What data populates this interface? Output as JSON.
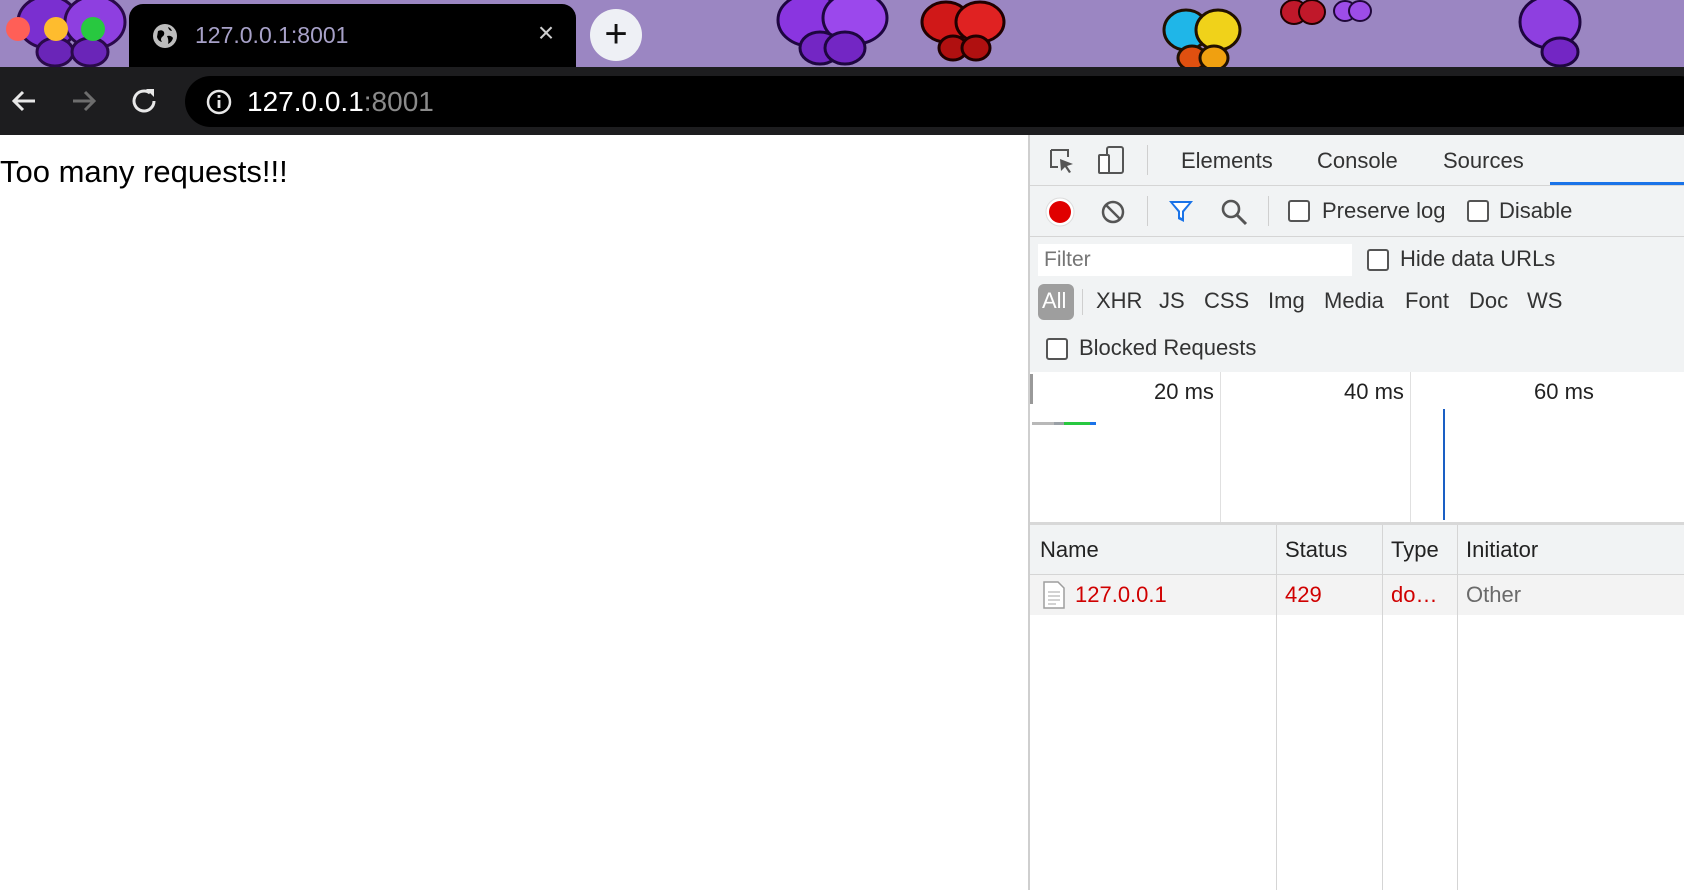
{
  "window": {
    "traffic_lights": {
      "close_color": "#ff5f57",
      "minimize_color": "#febc2e",
      "zoom_color": "#28c840"
    }
  },
  "tab": {
    "title": "127.0.0.1:8001",
    "favicon": "globe-icon",
    "close_icon": "close-icon"
  },
  "new_tab": {
    "icon": "plus-icon"
  },
  "toolbar": {
    "back_icon": "back-arrow-icon",
    "forward_icon": "forward-arrow-icon",
    "reload_icon": "reload-icon",
    "site_info_icon": "info-icon",
    "url_host": "127.0.0.1",
    "url_port": ":8001"
  },
  "page": {
    "message": "Too many requests!!!"
  },
  "devtools": {
    "tabs": [
      {
        "label": "Elements"
      },
      {
        "label": "Console"
      },
      {
        "label": "Sources"
      }
    ],
    "icons": {
      "inspect": "inspect-element-icon",
      "device": "device-toolbar-icon",
      "record": "record-icon",
      "clear": "clear-icon",
      "filter": "filter-icon",
      "search": "search-icon"
    },
    "record_color": "#e00000",
    "filter_icon_color": "#1a73e8",
    "preserve_log": "Preserve log",
    "disable_cache": "Disable",
    "filter_placeholder": "Filter",
    "hide_data_urls": "Hide data URLs",
    "types": [
      "All",
      "XHR",
      "JS",
      "CSS",
      "Img",
      "Media",
      "Font",
      "Doc",
      "WS"
    ],
    "active_type": "All",
    "blocked_requests": "Blocked Requests",
    "timeline_ticks": [
      "20 ms",
      "40 ms",
      "60 ms"
    ],
    "columns": [
      "Name",
      "Status",
      "Type",
      "Initiator"
    ],
    "requests": [
      {
        "name": "127.0.0.1",
        "status": "429",
        "type": "do…",
        "initiator": "Other",
        "icon": "document-icon",
        "error_color": "#d00000"
      }
    ]
  }
}
